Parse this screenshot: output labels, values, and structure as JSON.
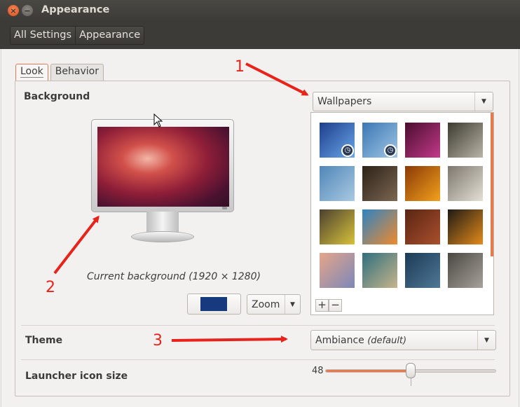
{
  "window": {
    "title": "Appearance",
    "close_icon": "close-icon",
    "minimize_icon": "minimize-icon"
  },
  "breadcrumb": [
    "All Settings",
    "Appearance"
  ],
  "tabs": [
    {
      "label": "Look",
      "active": true
    },
    {
      "label": "Behavior",
      "active": false
    }
  ],
  "background": {
    "label": "Background",
    "source_select": "Wallpapers",
    "caption": "Current background (1920 × 1280)",
    "color_swatch": "#17397e",
    "mode_select": "Zoom",
    "add_label": "+",
    "remove_label": "−",
    "accent_color": "#e8794b"
  },
  "wallpapers": [
    {
      "name": "blue-streaks",
      "has_clock": true,
      "colors": [
        "#1c3e8a",
        "#6aa6e8"
      ]
    },
    {
      "name": "birds-sky",
      "has_clock": true,
      "colors": [
        "#3b77b4",
        "#9fc5e4"
      ]
    },
    {
      "name": "magenta-flower",
      "has_clock": false,
      "colors": [
        "#4a0d2e",
        "#c33a8a"
      ]
    },
    {
      "name": "white-blossoms",
      "has_clock": false,
      "colors": [
        "#3d3a30",
        "#b8b4a6"
      ]
    },
    {
      "name": "birds-flock",
      "has_clock": false,
      "colors": [
        "#4f86b8",
        "#a9c9e2"
      ]
    },
    {
      "name": "dark-ground",
      "has_clock": false,
      "colors": [
        "#2b2219",
        "#7c6650"
      ]
    },
    {
      "name": "orange-lily",
      "has_clock": false,
      "colors": [
        "#8a3a06",
        "#f2a11d"
      ]
    },
    {
      "name": "dandelion",
      "has_clock": false,
      "colors": [
        "#7d776d",
        "#e4e0d6"
      ]
    },
    {
      "name": "yellow-flower",
      "has_clock": false,
      "colors": [
        "#4b4030",
        "#d7c23a"
      ]
    },
    {
      "name": "graffiti",
      "has_clock": false,
      "colors": [
        "#2c84c4",
        "#f08a2c"
      ]
    },
    {
      "name": "rust-leaf",
      "has_clock": false,
      "colors": [
        "#5a2512",
        "#a9502d"
      ]
    },
    {
      "name": "orange-swirl",
      "has_clock": false,
      "colors": [
        "#1e1a14",
        "#e48b1b"
      ]
    },
    {
      "name": "sunset-city",
      "has_clock": false,
      "colors": [
        "#e6a58a",
        "#7b88b8"
      ]
    },
    {
      "name": "teal-abstract",
      "has_clock": false,
      "colors": [
        "#2f6f7f",
        "#c7b48a"
      ]
    },
    {
      "name": "blue-tiles",
      "has_clock": false,
      "colors": [
        "#1c3a55",
        "#4e7896"
      ]
    },
    {
      "name": "grey-bokeh",
      "has_clock": false,
      "colors": [
        "#4a4743",
        "#a7a29a"
      ]
    }
  ],
  "theme": {
    "label": "Theme",
    "value": "Ambiance",
    "suffix": "(default)"
  },
  "launcher": {
    "label": "Launcher icon size",
    "value": "48",
    "fraction": 0.5
  },
  "annotations": {
    "n1": "1",
    "n2": "2",
    "n3": "3",
    "color": "#e8231b"
  }
}
